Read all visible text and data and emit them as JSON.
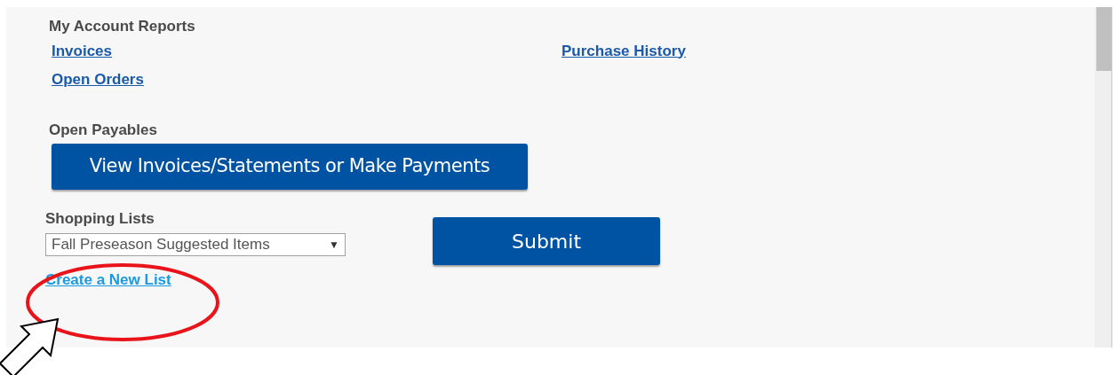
{
  "account_reports": {
    "heading": "My Account Reports",
    "links": [
      {
        "label": "Invoices"
      },
      {
        "label": "Open Orders"
      },
      {
        "label": "Purchase History"
      }
    ]
  },
  "open_payables": {
    "heading": "Open Payables",
    "button": "View Invoices/Statements or Make Payments"
  },
  "shopping_lists": {
    "heading": "Shopping Lists",
    "dropdown": {
      "value": "Fall Preseason Suggested Items",
      "caret": "▼"
    },
    "create_link": "Create a New List",
    "submit": "Submit"
  }
}
